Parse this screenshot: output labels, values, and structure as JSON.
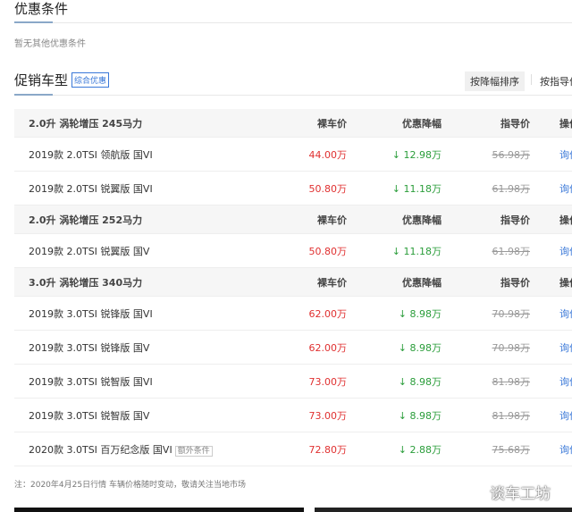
{
  "conditions": {
    "title": "优惠条件",
    "empty_text": "暂无其他优惠条件"
  },
  "promo": {
    "title": "促销车型",
    "tag": "综合优惠",
    "sort_drop": "按降幅排序",
    "sort_guide": "按指导价"
  },
  "groups": [
    {
      "name": "2.0升 涡轮增压 245马力",
      "cols": [
        "裸车价",
        "优惠降幅",
        "指导价",
        "操作"
      ],
      "rows": [
        {
          "name": "2019款 2.0TSI 领航版 国VI",
          "price": "44.00万",
          "drop": "↓ 12.98万",
          "guide": "56.98万",
          "action": "询价"
        },
        {
          "name": "2019款 2.0TSI 锐翼版 国VI",
          "price": "50.80万",
          "drop": "↓ 11.18万",
          "guide": "61.98万",
          "action": "询价"
        }
      ]
    },
    {
      "name": "2.0升 涡轮增压 252马力",
      "cols": [
        "裸车价",
        "优惠降幅",
        "指导价",
        "操作"
      ],
      "rows": [
        {
          "name": "2019款 2.0TSI 锐翼版 国V",
          "price": "50.80万",
          "drop": "↓ 11.18万",
          "guide": "61.98万",
          "action": "询价"
        }
      ]
    },
    {
      "name": "3.0升 涡轮增压 340马力",
      "cols": [
        "裸车价",
        "优惠降幅",
        "指导价",
        "操作"
      ],
      "rows": [
        {
          "name": "2019款 3.0TSI 锐锋版 国VI",
          "price": "62.00万",
          "drop": "↓ 8.98万",
          "guide": "70.98万",
          "action": "询价"
        },
        {
          "name": "2019款 3.0TSI 锐锋版 国V",
          "price": "62.00万",
          "drop": "↓ 8.98万",
          "guide": "70.98万",
          "action": "询价"
        },
        {
          "name": "2019款 3.0TSI 锐智版 国VI",
          "price": "73.00万",
          "drop": "↓ 8.98万",
          "guide": "81.98万",
          "action": "询价"
        },
        {
          "name": "2019款 3.0TSI 锐智版 国V",
          "price": "73.00万",
          "drop": "↓ 8.98万",
          "guide": "81.98万",
          "action": "询价"
        },
        {
          "name": "2020款 3.0TSI 百万纪念版 国VI",
          "extra": "额外条件",
          "price": "72.80万",
          "drop": "↓ 2.88万",
          "guide": "75.68万",
          "action": "询价"
        }
      ]
    }
  ],
  "note": "注：2020年4月25日行情 车辆价格随时变动，敬请关注当地市场",
  "watermark": "谈车工坊"
}
